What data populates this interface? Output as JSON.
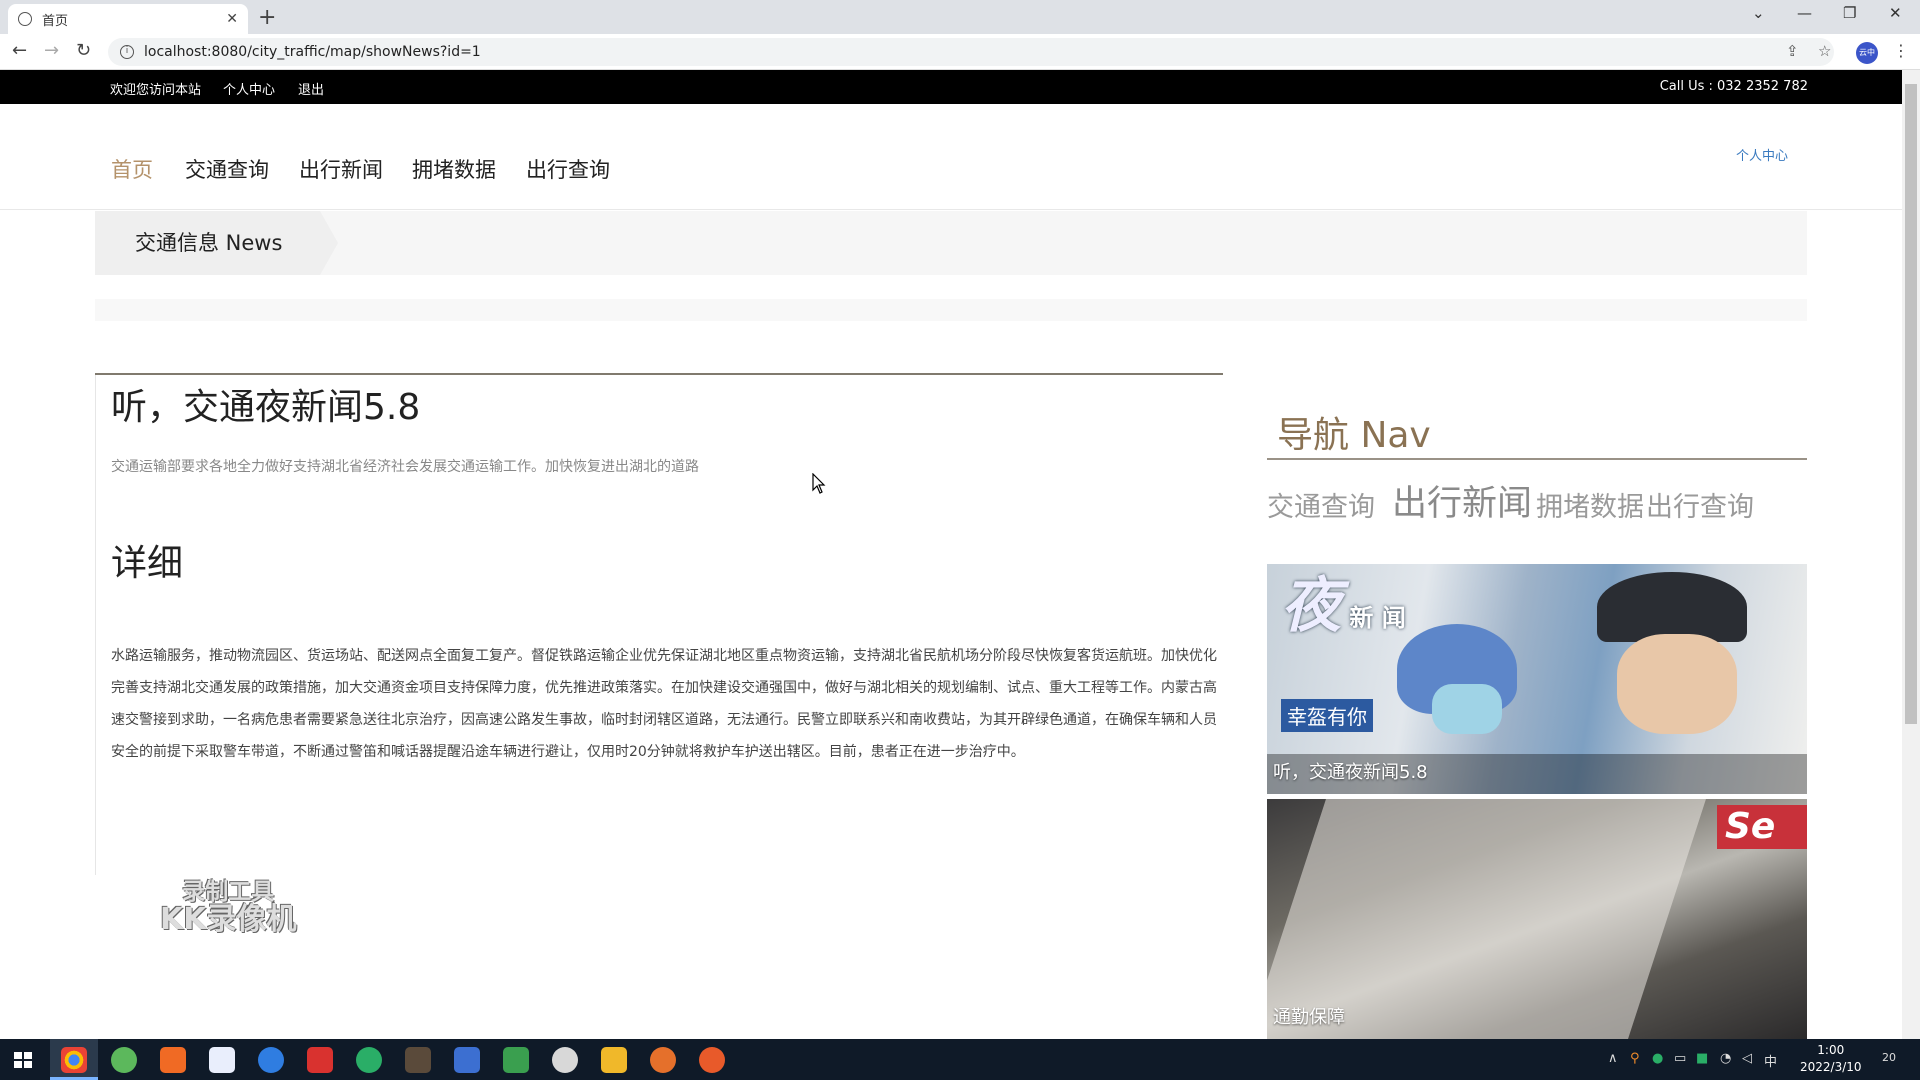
{
  "browser": {
    "tab_title": "首页",
    "tab_close": "✕",
    "new_tab": "+",
    "url": "localhost:8080/city_traffic/map/showNews?id=1",
    "avatar_text": "云中"
  },
  "topbar": {
    "links": [
      "欢迎您访问本站",
      "个人中心",
      "退出"
    ],
    "call": "Call Us : 032 2352 782"
  },
  "nav": {
    "items": [
      "首页",
      "交通查询",
      "出行新闻",
      "拥堵数据",
      "出行查询"
    ],
    "user_link": "个人中心"
  },
  "banner": {
    "title": "交通信息 News"
  },
  "article": {
    "title": "听，交通夜新闻5.8",
    "summary": "交通运输部要求各地全力做好支持湖北省经济社会发展交通运输工作。加快恢复进出湖北的道路",
    "detail_heading": "详细",
    "body": "水路运输服务，推动物流园区、货运场站、配送网点全面复工复产。督促铁路运输企业优先保证湖北地区重点物资运输，支持湖北省民航机场分阶段尽快恢复客货运航班。加快优化完善支持湖北交通发展的政策措施，加大交通资金项目支持保障力度，优先推进政策落实。在加快建设交通强国中，做好与湖北相关的规划编制、试点、重大工程等工作。内蒙古高速交警接到求助，一名病危患者需要紧急送往北京治疗，因高速公路发生事故，临时封闭辖区道路，无法通行。民警立即联系兴和南收费站，为其开辟绿色通道，在确保车辆和人员安全的前提下采取警车带道，不断通过警笛和喊话器提醒沿途车辆进行避让，仅用时20分钟就将救护车护送出辖区。目前，患者正在进一步治疗中。"
  },
  "sidebar": {
    "title": "导航 Nav",
    "links": [
      "交通查询",
      "出行新闻",
      "拥堵数据",
      "出行查询"
    ],
    "cards": [
      {
        "caption": "听，交通夜新闻5.8",
        "logo_small": "新",
        "logo_big": "夜",
        "logo_small2": "闻",
        "slogan": "幸盔有你"
      },
      {
        "caption": "通勤保障",
        "badge": "Se"
      }
    ]
  },
  "watermark": {
    "line1": "录制工具",
    "line2": "KK录像机"
  },
  "taskbar": {
    "time": "1:00",
    "date": "2022/3/10",
    "ime": "中",
    "notify": "20"
  }
}
